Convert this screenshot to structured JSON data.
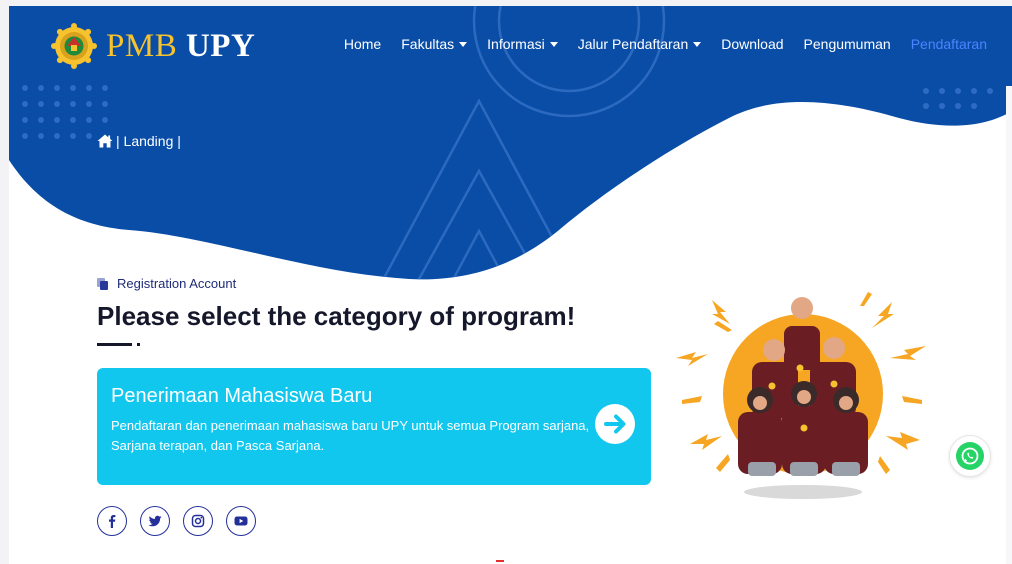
{
  "colors": {
    "primary_blue": "#0a4da7",
    "accent_yellow": "#f6c22e",
    "active_link": "#4c82ff",
    "card_cyan": "#12c7ee",
    "title_dark": "#15172b",
    "label_navy": "#1e2c78",
    "whatsapp_green": "#25d366"
  },
  "brand": {
    "pmb": "PMB ",
    "upy": "UPY",
    "logo_icon": "university-seal-icon"
  },
  "nav": {
    "items": [
      {
        "label": "Home",
        "dropdown": false
      },
      {
        "label": "Fakultas",
        "dropdown": true
      },
      {
        "label": "Informasi",
        "dropdown": true
      },
      {
        "label": "Jalur Pendaftaran",
        "dropdown": true
      },
      {
        "label": "Download",
        "dropdown": false
      },
      {
        "label": "Pengumuman",
        "dropdown": false
      },
      {
        "label": "Pendaftaran",
        "dropdown": false,
        "active": true
      }
    ]
  },
  "breadcrumb": {
    "icon": "home-icon",
    "text": "| Landing |"
  },
  "section": {
    "label": "Registration Account",
    "title": "Please select the category of program!"
  },
  "program_card": {
    "title": "Penerimaan Mahasiswa Baru",
    "description": "Pendaftaran dan penerimaan mahasiswa baru UPY untuk semua Program sarjana, Sarjana terapan, dan Pasca Sarjana.",
    "action_icon": "arrow-right-circle-icon"
  },
  "socials": [
    "facebook-icon",
    "twitter-icon",
    "instagram-icon",
    "youtube-icon"
  ],
  "floating": {
    "whatsapp_icon": "whatsapp-icon"
  }
}
